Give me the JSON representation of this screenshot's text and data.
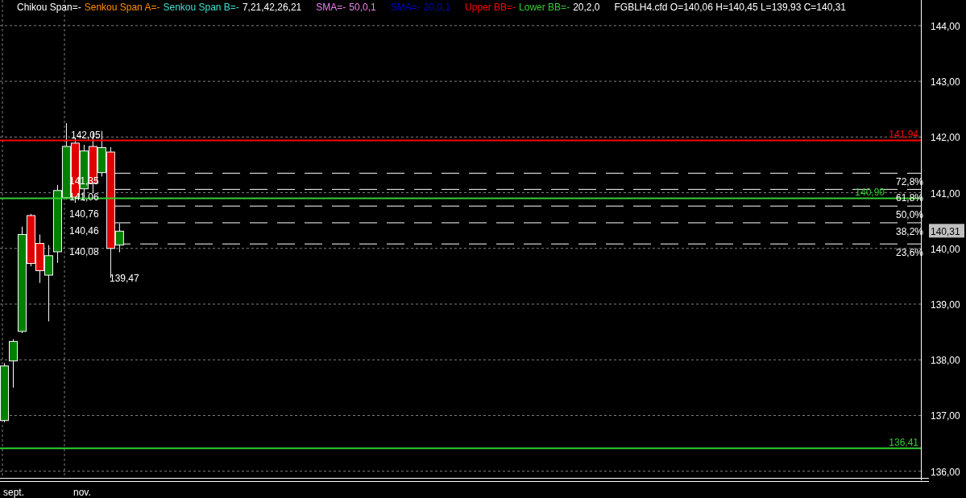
{
  "legend": [
    [
      {
        "text": "Chikou Span=-",
        "color": "#ffffff"
      },
      {
        "text": "Senkou Span A=-",
        "color": "#ff8c00"
      },
      {
        "text": "Senkou Span B=-",
        "color": "#40e0d0"
      },
      {
        "text": "7,21,42,26,21",
        "color": "#ffffff"
      }
    ],
    [
      {
        "text": "SMA=-",
        "color": "#ee82ee"
      },
      {
        "text": "50,0,1",
        "color": "#ee82ee"
      }
    ],
    [
      {
        "text": "SMA=-",
        "color": "#0000cd"
      },
      {
        "text": "20,0,1",
        "color": "#0000cd"
      }
    ],
    [
      {
        "text": "Upper BB=-",
        "color": "#ff0000"
      },
      {
        "text": "Lower BB=-",
        "color": "#32cd32"
      },
      {
        "text": "20,2,0",
        "color": "#ffffff"
      }
    ],
    [
      {
        "text": "FGBLH4.cfd O=140,06 H=140,45 L=139,93 C=140,31",
        "color": "#ffffff"
      }
    ]
  ],
  "chart_data": {
    "type": "candlestick",
    "categories": [
      null,
      null,
      null,
      null,
      null,
      null,
      null,
      null,
      null,
      null,
      null,
      null,
      null,
      null,
      null,
      null,
      null,
      null,
      null,
      null,
      null,
      null,
      null,
      null,
      null,
      null,
      null,
      null,
      null,
      null,
      null,
      null,
      null,
      null,
      null,
      null,
      null,
      null,
      null,
      null,
      null,
      null,
      null,
      null,
      null,
      null,
      null,
      null,
      null,
      null,
      null,
      null,
      null,
      null,
      null,
      null,
      null,
      null,
      null,
      null,
      null,
      null,
      null,
      null,
      null,
      null,
      null,
      null,
      null,
      null,
      null,
      null,
      null,
      null,
      null,
      null,
      null,
      null,
      null,
      null,
      null,
      null,
      null,
      null,
      null,
      null,
      null,
      null,
      null,
      null,
      null,
      null,
      null,
      null,
      null,
      null,
      null,
      null,
      null,
      null,
      null,
      null,
      null,
      null
    ],
    "ohlc": [
      [
        136.91,
        137.94,
        136.88,
        137.89
      ],
      [
        137.98,
        138.37,
        137.5,
        138.33
      ],
      [
        138.51,
        140.39,
        138.48,
        140.25
      ],
      [
        140.59,
        140.62,
        139.68,
        139.73
      ],
      [
        140.09,
        140.25,
        139.38,
        139.6
      ],
      [
        139.52,
        140.06,
        138.69,
        139.87
      ],
      [
        139.94,
        141.14,
        139.74,
        141.04
      ],
      [
        140.91,
        142.25,
        140.88,
        141.83
      ],
      [
        141.89,
        141.98,
        140.82,
        140.92
      ],
      [
        141.07,
        141.86,
        140.85,
        141.75
      ],
      [
        141.83,
        142.08,
        141.0,
        141.17
      ],
      [
        141.36,
        142.11,
        141.29,
        141.81
      ],
      [
        141.73,
        141.82,
        139.47,
        140.0
      ],
      [
        140.06,
        140.45,
        139.93,
        140.31
      ],
      null,
      null,
      null,
      null,
      null,
      null,
      null,
      null,
      null,
      null,
      null,
      null,
      null,
      null,
      null,
      null,
      null,
      null,
      null,
      null,
      null,
      null,
      null,
      null,
      null,
      null,
      null,
      null,
      null,
      null,
      null,
      null,
      null,
      null,
      null,
      null,
      null,
      null,
      null,
      null,
      null,
      null,
      null,
      null,
      null,
      null,
      null,
      null,
      null,
      null,
      null,
      null,
      null,
      null,
      null,
      null,
      null,
      null,
      null,
      null,
      null,
      null,
      null,
      null,
      null,
      null,
      null,
      null,
      null,
      null,
      null,
      null,
      null,
      null,
      null,
      null,
      null,
      null,
      null,
      null,
      null,
      null,
      null,
      null,
      null,
      null,
      null,
      null,
      null,
      null
    ],
    "ylim": [
      135.88,
      144.46
    ],
    "grid": true,
    "ref_lines": [
      {
        "axis": "y",
        "value": 141.94,
        "label": "141,94",
        "color": "#ff0000"
      },
      {
        "axis": "y",
        "value": 140.9,
        "label": "140,90",
        "color": "#32cd32"
      },
      {
        "axis": "y",
        "value": 136.41,
        "label": "136,41",
        "color": "#32cd32"
      }
    ],
    "yticks": [
      {
        "value": 144,
        "label": "144,00"
      },
      {
        "value": 143,
        "label": "143,00"
      },
      {
        "value": 142,
        "label": "142,00"
      },
      {
        "value": 141,
        "label": "141,00"
      },
      {
        "value": 140,
        "label": "140,00"
      },
      {
        "value": 139,
        "label": "139,00"
      },
      {
        "value": 138,
        "label": "138,00"
      },
      {
        "value": 137,
        "label": "137,00"
      },
      {
        "value": 136,
        "label": "136,00"
      }
    ]
  },
  "x_axis": {
    "labels": [
      "sept.",
      "nov."
    ]
  },
  "current_price": "140,31",
  "fibonacci": {
    "high": "142,05",
    "low": "139,47",
    "levels": [
      {
        "price": "141,35",
        "percent": "72,8%"
      },
      {
        "price": "141,06",
        "percent": "61,8%"
      },
      {
        "price": "140,76",
        "percent": "50,0%"
      },
      {
        "price": "140,46",
        "percent": "38,2%"
      },
      {
        "price": "140,08",
        "percent": "23,6%"
      }
    ]
  }
}
